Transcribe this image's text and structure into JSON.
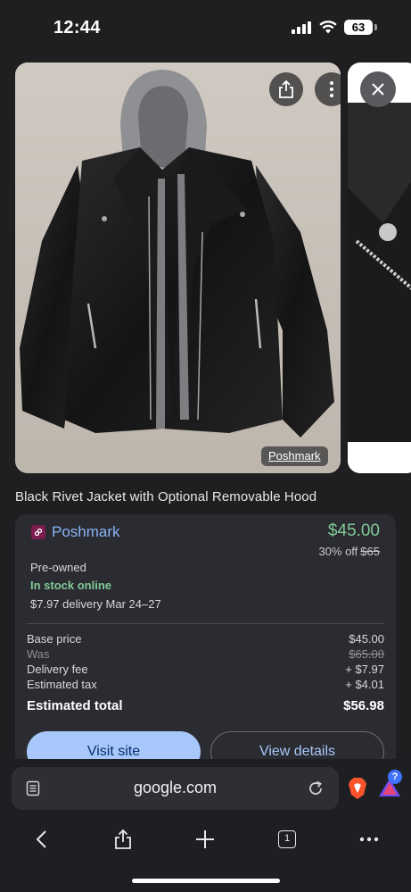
{
  "status_bar": {
    "time": "12:44",
    "battery": "63"
  },
  "image_viewer": {
    "source_tag": "Poshmark"
  },
  "product": {
    "title": "Black Rivet Jacket with Optional Removable Hood"
  },
  "offer": {
    "merchant": "Poshmark",
    "price": "$45.00",
    "discount": "30% off",
    "original_price": "$65",
    "condition": "Pre-owned",
    "stock": "In stock online",
    "delivery": "$7.97 delivery Mar 24–27",
    "breakdown": {
      "base_label": "Base price",
      "base_value": "$45.00",
      "was_label": "Was",
      "was_value": "$65.00",
      "delivery_label": "Delivery fee",
      "delivery_value": "+ $7.97",
      "tax_label": "Estimated tax",
      "tax_value": "+ $4.01",
      "total_label": "Estimated total",
      "total_value": "$56.98"
    },
    "visit_button": "Visit site",
    "details_button": "View details"
  },
  "browser": {
    "url": "google.com",
    "tab_count": "1",
    "rewards_badge": "?"
  },
  "colors": {
    "background": "#1f1f21",
    "card": "#2b2c31",
    "price_green": "#81c995",
    "link_blue": "#8ab4f8",
    "button_blue": "#a8c7fa"
  }
}
